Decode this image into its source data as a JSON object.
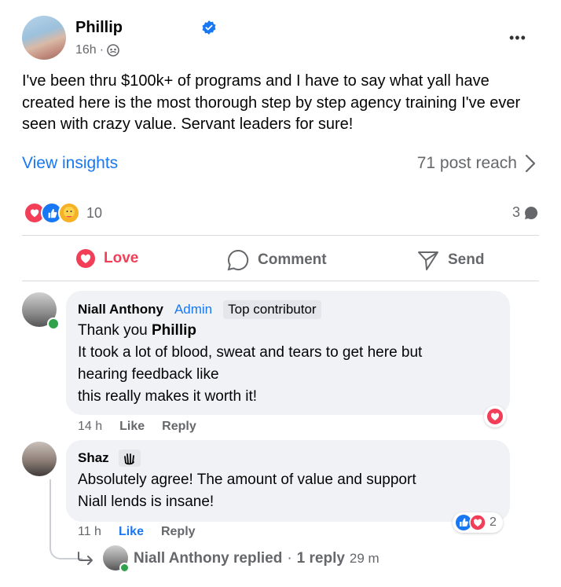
{
  "post": {
    "author": "Phillip",
    "time": "16h",
    "separator": "·",
    "privacy_icon": "group-icon",
    "more_label": "•••",
    "text": "I've been thru $100k+ of programs and I have to say what yall have created here is the most thorough step by step agency training I've ever seen with crazy value. Servant leaders for sure!",
    "insights_label": "View insights",
    "reach_label": "71 post reach",
    "reaction_count": "10",
    "comment_count": "3"
  },
  "actions": {
    "love": "Love",
    "comment": "Comment",
    "send": "Send"
  },
  "comments": [
    {
      "name": "Niall Anthony",
      "role": "Admin",
      "badge": "Top contributor",
      "text_lead": "Thank you ",
      "mention": "Phillip",
      "text_line2": "It took a lot of blood, sweat and tears to get here but",
      "text_line3": "hearing feedback like",
      "text_line4": "this really makes it worth it!",
      "time": "14 h",
      "like": "Like",
      "reply": "Reply"
    },
    {
      "name": "Shaz",
      "text_line1": "Absolutely agree! The amount of value and support",
      "text_line2": "Niall lends is insane!",
      "time": "11 h",
      "like": "Like",
      "reply": "Reply",
      "reaction_count": "2"
    }
  ],
  "replies_summary": {
    "text": "Niall Anthony replied",
    "separator": "·",
    "count": "1 reply",
    "time": "29 m"
  },
  "colors": {
    "accent": "#1877f2",
    "love": "#f33e58",
    "muted": "#65676b",
    "bubble": "#f0f2f5"
  }
}
